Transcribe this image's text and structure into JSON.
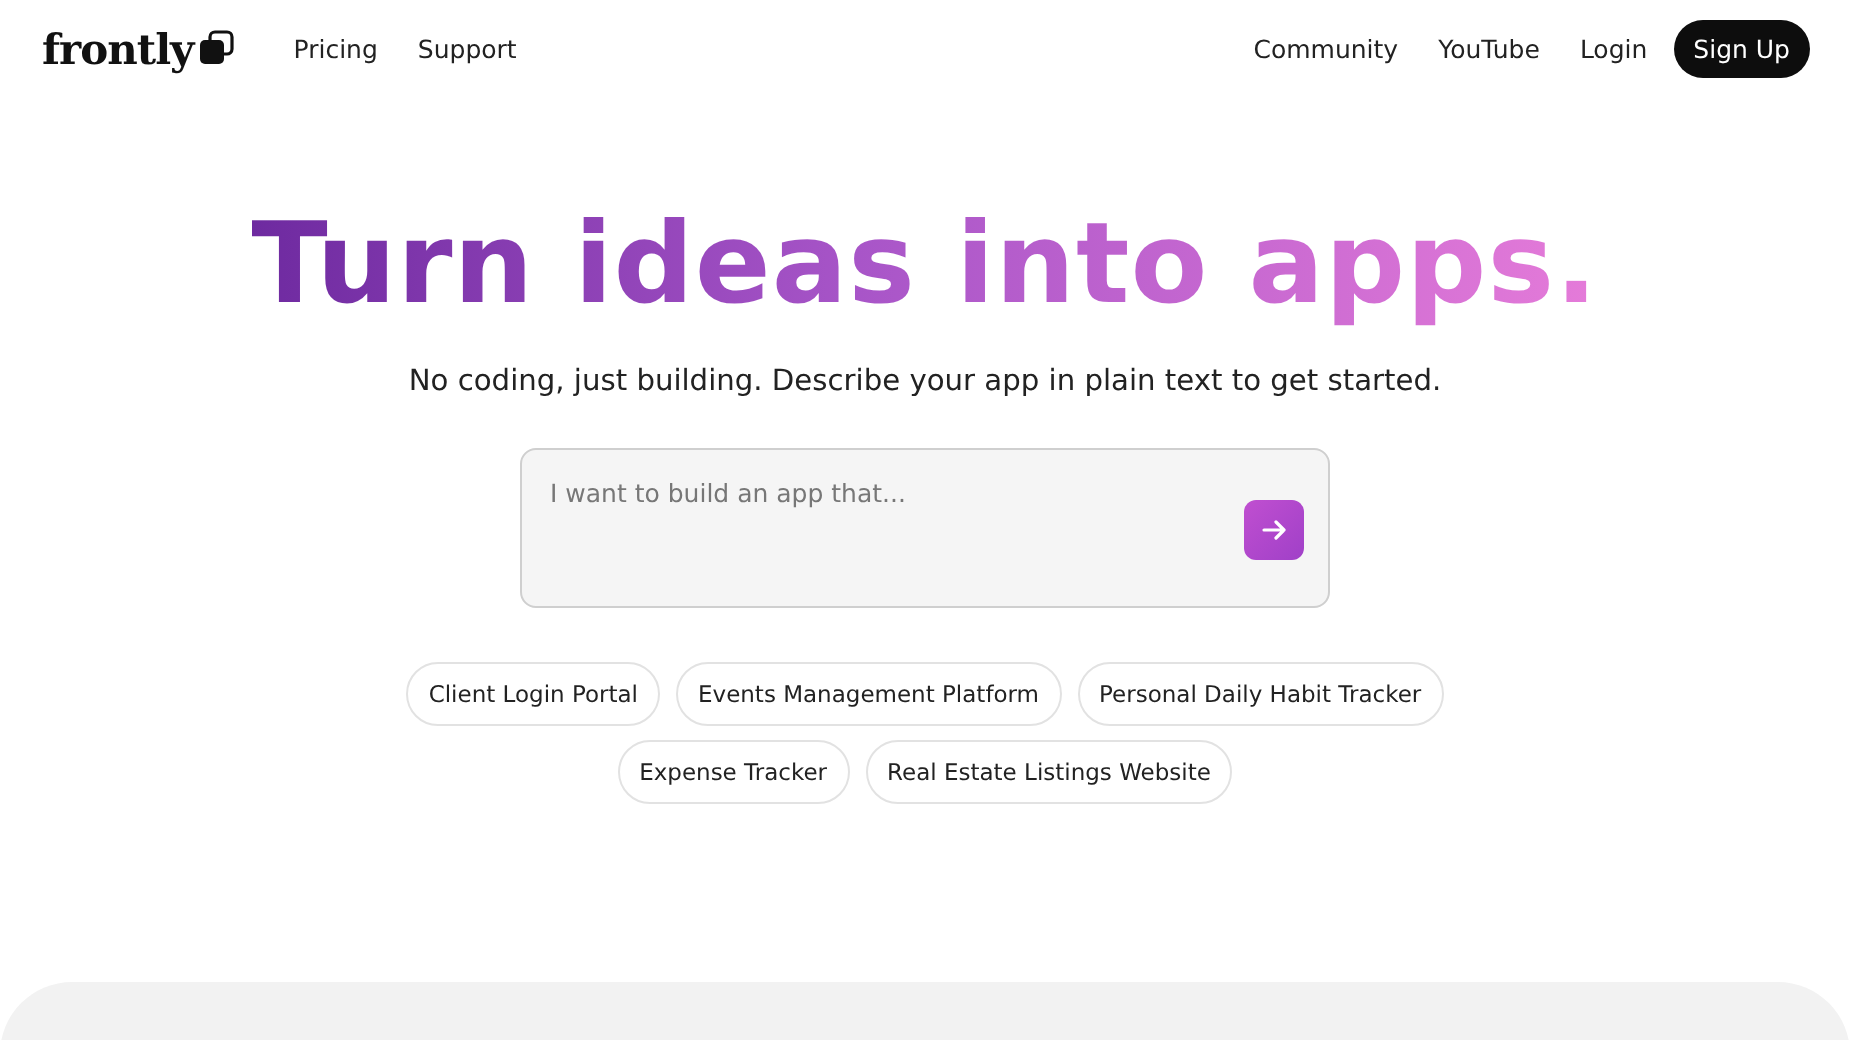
{
  "nav": {
    "logo": "frontly",
    "left_links": [
      "Pricing",
      "Support"
    ],
    "right_links": [
      "Community",
      "YouTube",
      "Login"
    ],
    "cta": "Sign Up"
  },
  "hero": {
    "title": "Turn ideas into apps.",
    "subtitle": "No coding, just building. Describe your app in plain text to get started."
  },
  "prompt": {
    "placeholder": "I want to build an app that..."
  },
  "suggestions": [
    [
      "Client Login Portal",
      "Events Management Platform",
      "Personal Daily Habit Tracker"
    ],
    [
      "Expense Tracker",
      "Real Estate Listings Website"
    ]
  ]
}
